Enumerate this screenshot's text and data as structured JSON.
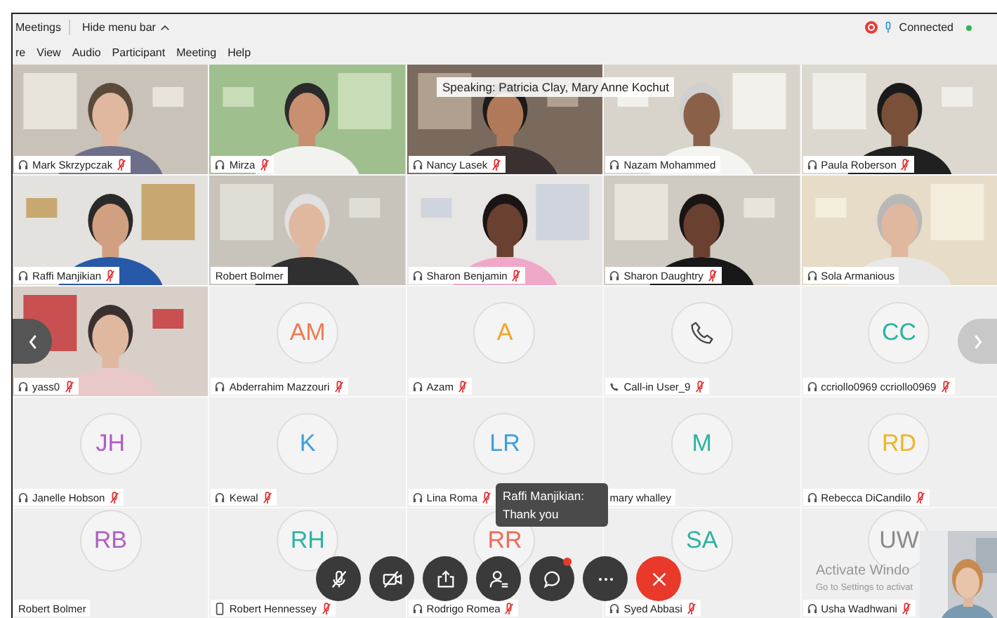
{
  "title_bar": {
    "items": [
      "Meetings",
      "Hide menu bar"
    ],
    "status": "Connected",
    "recording": true,
    "connected": true
  },
  "menu": [
    "re",
    "View",
    "Audio",
    "Participant",
    "Meeting",
    "Help"
  ],
  "speaking": "Speaking: Patricia Clay, Mary Anne Kochut",
  "tiles": [
    {
      "kind": "video",
      "name": "Mark Skrzypczak",
      "audio": {
        "kind": "mic",
        "muted": true
      }
    },
    {
      "kind": "video",
      "name": "Mirza",
      "audio": {
        "kind": "mic",
        "muted": true
      }
    },
    {
      "kind": "video",
      "name": "Nancy Lasek",
      "audio": {
        "kind": "mic",
        "muted": true
      }
    },
    {
      "kind": "video",
      "name": "Nazam Mohammed",
      "audio": {
        "kind": "mic",
        "muted": false
      }
    },
    {
      "kind": "video",
      "name": "Paula Roberson",
      "audio": {
        "kind": "mic",
        "muted": true
      }
    },
    {
      "kind": "video",
      "name": "Raffi Manjikian",
      "audio": {
        "kind": "mic",
        "muted": true
      }
    },
    {
      "kind": "video",
      "name": "Robert Bolmer"
    },
    {
      "kind": "video",
      "name": "Sharon Benjamin",
      "audio": {
        "kind": "mic",
        "muted": true
      }
    },
    {
      "kind": "video",
      "name": "Sharon Daughtry",
      "audio": {
        "kind": "mic",
        "muted": true
      }
    },
    {
      "kind": "video",
      "name": "Sola Armanious",
      "audio": {
        "kind": "mic",
        "muted": false
      }
    },
    {
      "kind": "video",
      "name": "yass0",
      "audio": {
        "kind": "mic",
        "muted": true
      }
    },
    {
      "kind": "avatar",
      "initials": "AM",
      "color": "#f07a52",
      "name": "Abderrahim Mazzouri",
      "audio": {
        "kind": "mic",
        "muted": true
      }
    },
    {
      "kind": "avatar",
      "initials": "A",
      "color": "#f0a426",
      "name": "Azam",
      "audio": {
        "kind": "mic",
        "muted": true
      }
    },
    {
      "kind": "phone",
      "name": "Call-in User_9",
      "audio": {
        "kind": "phone",
        "muted": true
      }
    },
    {
      "kind": "avatar",
      "initials": "CC",
      "color": "#2db3a0",
      "name": "ccriollo0969 ccriollo0969",
      "audio": {
        "kind": "mic",
        "muted": true
      }
    },
    {
      "kind": "avatar",
      "initials": "JH",
      "color": "#b05fc2",
      "name": "Janelle Hobson",
      "audio": {
        "kind": "mic",
        "muted": true
      }
    },
    {
      "kind": "avatar",
      "initials": "K",
      "color": "#3a9fe0",
      "name": "Kewal",
      "audio": {
        "kind": "mic",
        "muted": true
      }
    },
    {
      "kind": "avatar",
      "initials": "LR",
      "color": "#3a9fe0",
      "name": "Lina Roma",
      "audio": {
        "kind": "mic",
        "muted": true
      }
    },
    {
      "kind": "avatar",
      "initials": "M",
      "color": "#2db3a0",
      "name": "mary whalley"
    },
    {
      "kind": "avatar",
      "initials": "RD",
      "color": "#f0b428",
      "name": "Rebecca DiCandilo",
      "audio": {
        "kind": "mic",
        "muted": true
      }
    },
    {
      "kind": "avatar",
      "initials": "RB",
      "color": "#b05fc2",
      "name": "Robert Bolmer"
    },
    {
      "kind": "avatar",
      "initials": "RH",
      "color": "#2db3a0",
      "name": "Robert Hennessey",
      "audio": {
        "kind": "device",
        "muted": true
      }
    },
    {
      "kind": "avatar",
      "initials": "RR",
      "color": "#f06a5a",
      "name": "Rodrigo Romea",
      "audio": {
        "kind": "mic",
        "muted": true
      }
    },
    {
      "kind": "avatar",
      "initials": "SA",
      "color": "#2db3a0",
      "name": "Syed Abbasi",
      "audio": {
        "kind": "mic",
        "muted": true
      }
    },
    {
      "kind": "avatar",
      "initials": "UW",
      "color": "#8a8a8a",
      "name": "Usha Wadhwani",
      "audio": {
        "kind": "mic",
        "muted": true
      }
    }
  ],
  "chat_popup": {
    "sender": "Raffi Manjikian:",
    "message": "Thank you"
  },
  "toolbar": {
    "muted": true,
    "video_off": true,
    "chat_unread": true
  },
  "system_notice": {
    "title": "Activate Windo",
    "detail": "Go to Settings to activat"
  }
}
